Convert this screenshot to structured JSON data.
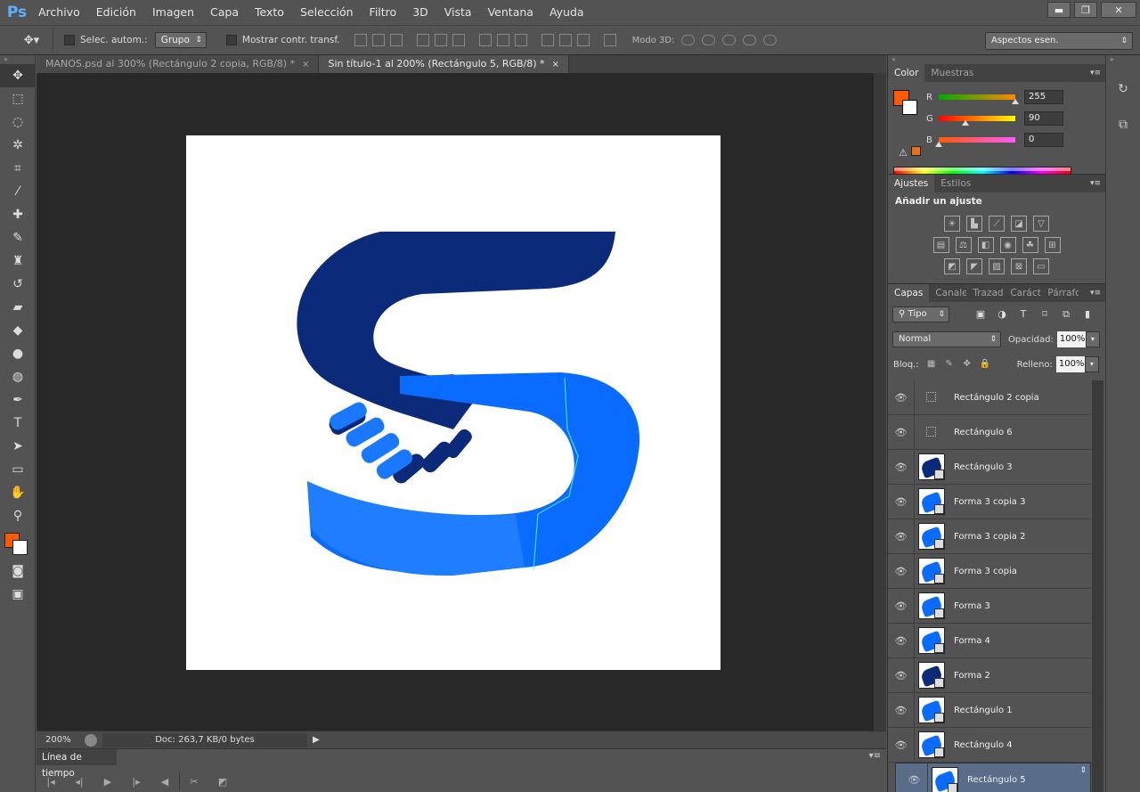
{
  "app": {
    "logo": "Ps"
  },
  "menu": [
    "Archivo",
    "Edición",
    "Imagen",
    "Capa",
    "Texto",
    "Selección",
    "Filtro",
    "3D",
    "Vista",
    "Ventana",
    "Ayuda"
  ],
  "window_controls": {
    "minimize": "▬",
    "restore": "❐",
    "close": "✕"
  },
  "options": {
    "tool_icon": "move-tool-icon",
    "auto_select_label": "Selec. autom.:",
    "auto_select_value": "Grupo",
    "show_transform_label": "Mostrar contr. transf.",
    "mode_3d_label": "Modo 3D:",
    "workspace": "Aspectos esen."
  },
  "tabs": [
    {
      "label": "MANOS.psd al 300% (Rectángulo 2 copia, RGB/8) *",
      "close": "×"
    },
    {
      "label": "Sin título-1 al 200% (Rectángulo 5, RGB/8) *",
      "close": "×"
    }
  ],
  "status": {
    "zoom": "200%",
    "doc": "Doc: 263,7 KB/0 bytes",
    "arrow": "▶"
  },
  "timeline": {
    "title": "Línea de tiempo",
    "menu": "▾≡"
  },
  "colors": {
    "foreground": "#ff5a00",
    "background": "#ffffff",
    "dark_blue": "#0b2a7a",
    "light_blue": "#0a6cff"
  },
  "color_panel": {
    "tabs": [
      "Color",
      "Muestras"
    ],
    "channels": [
      {
        "label": "R",
        "value": "255",
        "frac": 1.0
      },
      {
        "label": "G",
        "value": "90",
        "frac": 0.353
      },
      {
        "label": "B",
        "value": "0",
        "frac": 0.0
      }
    ]
  },
  "adjust_panel": {
    "tabs": [
      "Ajustes",
      "Estilos"
    ],
    "title": "Añadir un ajuste"
  },
  "layers_panel": {
    "tabs": [
      "Capas",
      "Canales",
      "Trazados",
      "Carácter",
      "Párrafo"
    ],
    "filter": "Tipo",
    "blend_mode": "Normal",
    "opacity_label": "Opacidad:",
    "opacity": "100%",
    "lock_label": "Bloq.:",
    "fill_label": "Relleno:",
    "fill": "100%",
    "layers": [
      {
        "name": "Rectángulo 2 copia",
        "thumb": "empty"
      },
      {
        "name": "Rectángulo 6",
        "thumb": "empty"
      },
      {
        "name": "Rectángulo 3",
        "thumb": "dark"
      },
      {
        "name": "Forma 3 copia 3",
        "thumb": "light"
      },
      {
        "name": "Forma 3 copia 2",
        "thumb": "light"
      },
      {
        "name": "Forma 3 copia",
        "thumb": "light"
      },
      {
        "name": "Forma 3",
        "thumb": "light"
      },
      {
        "name": "Forma 4",
        "thumb": "light"
      },
      {
        "name": "Forma 2",
        "thumb": "dark"
      },
      {
        "name": "Rectángulo 1",
        "thumb": "light"
      },
      {
        "name": "Rectángulo 4",
        "thumb": "light"
      },
      {
        "name": "Rectángulo 5",
        "thumb": "light",
        "selected": true
      }
    ]
  }
}
